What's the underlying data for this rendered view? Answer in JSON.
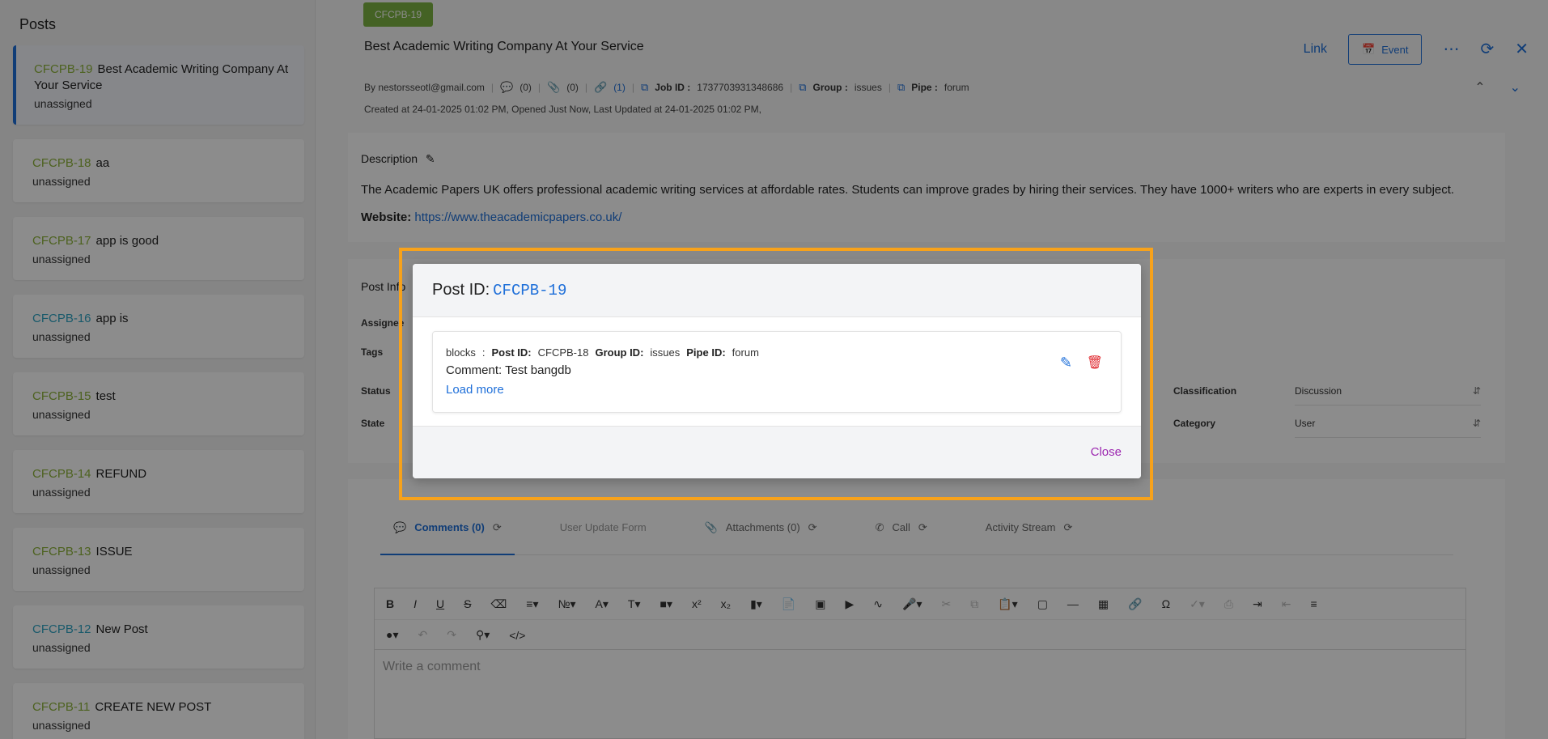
{
  "sidebar": {
    "title": "Posts",
    "items": [
      {
        "id": "CFCPB-19",
        "title": "Best Academic Writing Company At Your Service",
        "status": "unassigned"
      },
      {
        "id": "CFCPB-18",
        "title": "aa",
        "status": "unassigned"
      },
      {
        "id": "CFCPB-17",
        "title": "app is good",
        "status": "unassigned"
      },
      {
        "id": "CFCPB-16",
        "title": "app is",
        "status": "unassigned"
      },
      {
        "id": "CFCPB-15",
        "title": "test",
        "status": "unassigned"
      },
      {
        "id": "CFCPB-14",
        "title": "REFUND",
        "status": "unassigned"
      },
      {
        "id": "CFCPB-13",
        "title": "ISSUE",
        "status": "unassigned"
      },
      {
        "id": "CFCPB-12",
        "title": "New Post",
        "status": "unassigned"
      },
      {
        "id": "CFCPB-11",
        "title": "CREATE NEW POST",
        "status": "unassigned"
      }
    ]
  },
  "post": {
    "tag": "CFCPB-19",
    "title": "Best Academic Writing Company At Your Service",
    "toolbar": {
      "link": "Link",
      "event": "Event"
    },
    "meta": {
      "by": "By nestorsseotl@gmail.com",
      "comments": "(0)",
      "attachments": "(0)",
      "links": "(1)",
      "job_label": "Job ID :",
      "job_value": "1737703931348686",
      "group_label": "Group :",
      "group_value": "issues",
      "pipe_label": "Pipe :",
      "pipe_value": "forum"
    },
    "dates": "Created at 24-01-2025 01:02 PM,   Opened Just Now,   Last Updated at 24-01-2025 01:02 PM,",
    "description": {
      "label": "Description",
      "text": "The Academic Papers UK offers professional academic writing services at affordable rates. Students can improve grades by hiring their services. They have 1000+ writers who are experts in every subject.",
      "website_label": "Website:",
      "website_url": "https://www.theacademicpapers.co.uk/"
    },
    "info": {
      "title": "Post Info",
      "labels": [
        "Assignee",
        "Tags",
        "Status",
        "State"
      ],
      "classification_label": "Classification",
      "classification_value": "Discussion",
      "category_label": "Category",
      "category_value": "User"
    },
    "tabs": [
      {
        "label": "Comments (0)"
      },
      {
        "label": "User Update Form"
      },
      {
        "label": "Attachments (0)"
      },
      {
        "label": "Call"
      },
      {
        "label": "Activity Stream"
      }
    ],
    "editor": {
      "placeholder": "Write a comment"
    }
  },
  "modal": {
    "title_prefix": "Post ID:",
    "title_id": "CFCPB-19",
    "link": {
      "relation": "blocks",
      "colon": ":",
      "post_label": "Post ID:",
      "post_value": "CFCPB-18",
      "group_label": "Group ID:",
      "group_value": "issues",
      "pipe_label": "Pipe ID:",
      "pipe_value": "forum",
      "comment": "Comment: Test bangdb",
      "load_more": "Load more"
    },
    "close": "Close"
  },
  "colors": {
    "accent": "#1e6fd9",
    "tag_green": "#7cb342",
    "highlight": "#f7a21b",
    "danger": "#e0282e",
    "close": "#9c27b0"
  }
}
